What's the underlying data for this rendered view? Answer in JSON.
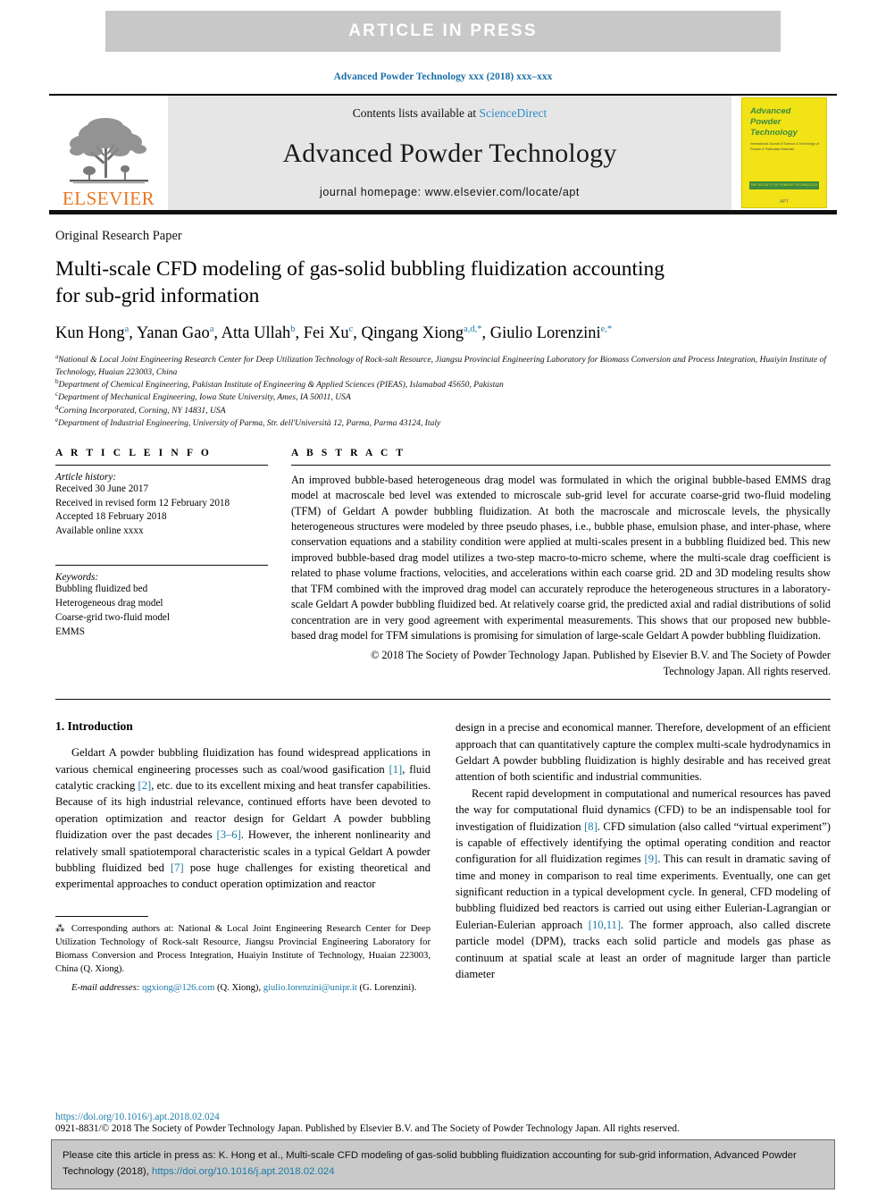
{
  "banner": {
    "label": "ARTICLE  IN  PRESS"
  },
  "running_head": "Advanced Powder Technology xxx (2018) xxx–xxx",
  "masthead": {
    "publisher_logo_name": "elsevier-tree-logo",
    "publisher_wordmark": "ELSEVIER",
    "contents_prefix": "Contents lists available at ",
    "contents_link": "ScienceDirect",
    "journal_title": "Advanced Powder Technology",
    "homepage_label": "journal homepage: www.elsevier.com/locate/apt",
    "cover": {
      "title_line1": "Advanced",
      "title_line2": "Powder",
      "title_line3": "Technology",
      "subtitle": "International Journal of Science & Technology of Powder & Particulate Materials",
      "bar_text": "THE SOCIETY OF POWDER TECHNOLOGY JAPAN",
      "logo_text": "APT"
    }
  },
  "article": {
    "type": "Original Research Paper",
    "title_line1": "Multi-scale CFD modeling of gas-solid bubbling fluidization accounting",
    "title_line2": "for sub-grid information",
    "authors": [
      {
        "name": "Kun Hong",
        "marks": "a"
      },
      {
        "name": "Yanan Gao",
        "marks": "a"
      },
      {
        "name": "Atta Ullah",
        "marks": "b"
      },
      {
        "name": "Fei Xu",
        "marks": "c"
      },
      {
        "name": "Qingang Xiong",
        "marks": "a,d,*"
      },
      {
        "name": "Giulio Lorenzini",
        "marks": "e,*"
      }
    ],
    "affiliations": [
      {
        "mark": "a",
        "text": "National & Local Joint Engineering Research Center for Deep Utilization Technology of Rock-salt Resource, Jiangsu Provincial Engineering Laboratory for Biomass Conversion and Process Integration, Huaiyin Institute of Technology, Huaian 223003, China"
      },
      {
        "mark": "b",
        "text": "Department of Chemical Engineering, Pakistan Institute of Engineering & Applied Sciences (PIEAS), Islamabad 45650, Pakistan"
      },
      {
        "mark": "c",
        "text": "Department of Mechanical Engineering, Iowa State University, Ames, IA 50011, USA"
      },
      {
        "mark": "d",
        "text": "Corning Incorporated, Corning, NY 14831, USA"
      },
      {
        "mark": "e",
        "text": "Department of Industrial Engineering, University of Parma, Str. dell'Università 12, Parma, Parma 43124, Italy"
      }
    ]
  },
  "article_info": {
    "heading": "A R T I C L E   I N F O",
    "history_label": "Article history:",
    "history": [
      "Received 30 June 2017",
      "Received in revised form 12 February 2018",
      "Accepted 18 February 2018",
      "Available online xxxx"
    ],
    "keywords_label": "Keywords:",
    "keywords": [
      "Bubbling fluidized bed",
      "Heterogeneous drag model",
      "Coarse-grid two-fluid model",
      "EMMS"
    ]
  },
  "abstract": {
    "heading": "A B S T R A C T",
    "body": "An improved bubble-based heterogeneous drag model was formulated in which the original bubble-based EMMS drag model at macroscale bed level was extended to microscale sub-grid level for accurate coarse-grid two-fluid modeling (TFM) of Geldart A powder bubbling fluidization. At both the macroscale and microscale levels, the physically heterogeneous structures were modeled by three pseudo phases, i.e., bubble phase, emulsion phase, and inter-phase, where conservation equations and a stability condition were applied at multi-scales present in a bubbling fluidized bed. This new improved bubble-based drag model utilizes a two-step macro-to-micro scheme, where the multi-scale drag coefficient is related to phase volume fractions, velocities, and accelerations within each coarse grid. 2D and 3D modeling results show that TFM combined with the improved drag model can accurately reproduce the heterogeneous structures in a laboratory-scale Geldart A powder bubbling fluidized bed. At relatively coarse grid, the predicted axial and radial distributions of solid concentration are in very good agreement with experimental measurements. This shows that our proposed new bubble-based drag model for TFM simulations is promising for simulation of large-scale Geldart A powder bubbling fluidization.",
    "copyright_line1": "© 2018 The Society of Powder Technology Japan. Published by Elsevier B.V. and The Society of Powder",
    "copyright_line2": "Technology Japan. All rights reserved."
  },
  "introduction": {
    "heading": "1. Introduction",
    "left_para_1_a": "Geldart A powder bubbling fluidization has found widespread applications in various chemical engineering processes such as coal/wood gasification ",
    "left_cit_1": "[1]",
    "left_para_1_b": ", fluid catalytic cracking ",
    "left_cit_2": "[2]",
    "left_para_1_c": ", etc. due to its excellent mixing and heat transfer capabilities. Because of its high industrial relevance, continued efforts have been devoted to operation optimization and reactor design for Geldart A powder bubbling fluidization over the past decades ",
    "left_cit_3": "[3–6]",
    "left_para_1_d": ". However, the inherent nonlinearity and relatively small spatiotemporal characteristic scales in a typical Geldart A powder bubbling fluidized bed ",
    "left_cit_4": "[7]",
    "left_para_1_e": " pose huge challenges for existing theoretical and experimental approaches to conduct operation optimization and reactor",
    "right_para_1": "design in a precise and economical manner. Therefore, development of an efficient approach that can quantitatively capture the complex multi-scale hydrodynamics in Geldart A powder bubbling fluidization is highly desirable and has received great attention of both scientific and industrial communities.",
    "right_para_2_a": "Recent rapid development in computational and numerical resources has paved the way for computational fluid dynamics (CFD) to be an indispensable tool for investigation of fluidization ",
    "right_cit_1": "[8]",
    "right_para_2_b": ". CFD simulation (also called “virtual experiment”) is capable of effectively identifying the optimal operating condition and reactor configuration for all fluidization regimes ",
    "right_cit_2": "[9]",
    "right_para_2_c": ". This can result in dramatic saving of time and money in comparison to real time experiments. Eventually, one can get significant reduction in a typical development cycle. In general, CFD modeling of bubbling fluidized bed reactors is carried out using either Eulerian-Lagrangian or Eulerian-Eulerian approach ",
    "right_cit_3": "[10,11]",
    "right_para_2_d": ". The former approach, also called discrete particle model (DPM), tracks each solid particle and models gas phase as continuum at spatial scale at least an order of magnitude larger than particle diameter"
  },
  "footnote": {
    "star": "⁂",
    "text": " Corresponding authors at: National & Local Joint Engineering Research Center for Deep Utilization Technology of Rock-salt Resource, Jiangsu Provincial Engineering Laboratory for Biomass Conversion and Process Integration, Huaiyin Institute of Technology, Huaian 223003, China (Q. Xiong).",
    "email_label": "E-mail addresses:",
    "email_1": "qgxiong@126.com",
    "email_1_owner": " (Q. Xiong), ",
    "email_2": "giulio.lorenzini@unipr.it",
    "email_2_owner": " (G. Lorenzini)."
  },
  "footer": {
    "doi": "https://doi.org/10.1016/j.apt.2018.02.024",
    "issn": "0921-8831/© 2018 The Society of Powder Technology Japan. Published by Elsevier B.V. and The Society of Powder Technology Japan. All rights reserved."
  },
  "cite_box": {
    "text_before_link": "Please cite this article in press as: K. Hong et al., Multi-scale CFD modeling of gas-solid bubbling fluidization accounting for sub-grid information, Advanced Powder Technology (2018), ",
    "link": "https://doi.org/10.1016/j.apt.2018.02.024"
  },
  "colors": {
    "link_blue": "#1a7aa8",
    "sciencedirect_blue": "#2e8bc8",
    "elsevier_orange": "#e87722",
    "cover_yellow": "#f2e316",
    "cover_green": "#3d8c40",
    "banner_gray": "#c8c8c8",
    "cite_box_gray": "#c9c9c9"
  }
}
